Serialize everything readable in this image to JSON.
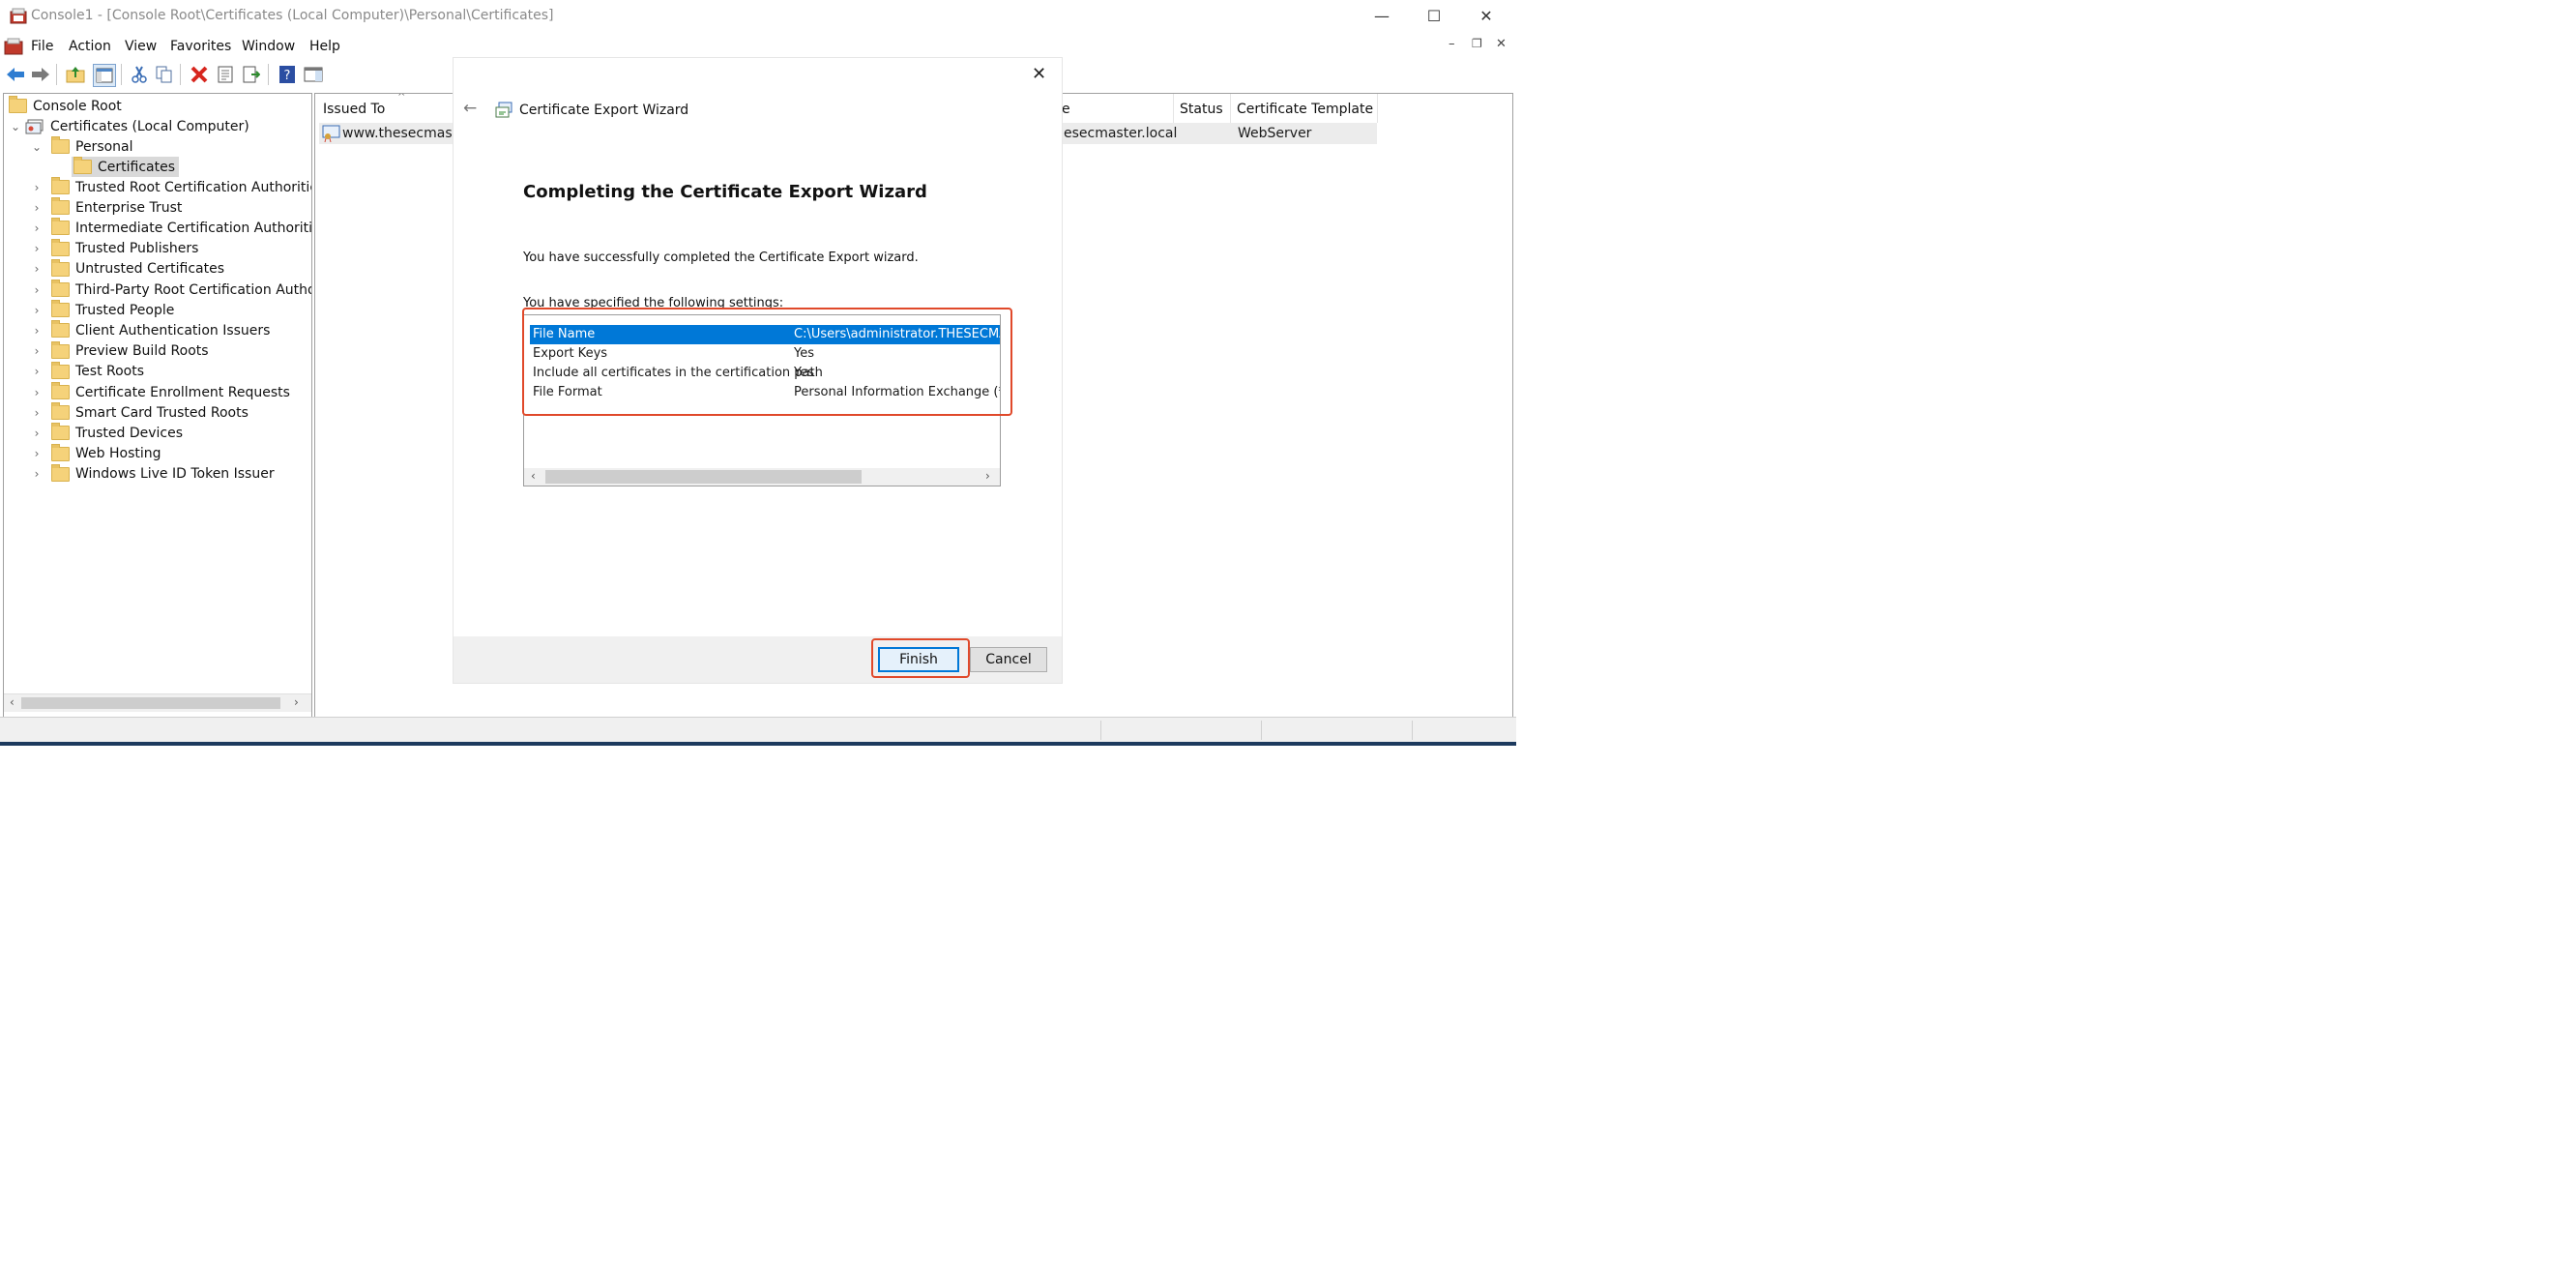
{
  "window": {
    "title": "Console1 - [Console Root\\Certificates (Local Computer)\\Personal\\Certificates]",
    "controls": {
      "minimize": "—",
      "maximize": "☐",
      "close": "✕"
    },
    "mdi_controls": {
      "minimize": "–",
      "restore": "❐",
      "close": "✕"
    }
  },
  "menu": [
    "File",
    "Action",
    "View",
    "Favorites",
    "Window",
    "Help"
  ],
  "tree": {
    "root": "Console Root",
    "store": "Certificates (Local Computer)",
    "personal": "Personal",
    "selected": "Certificates",
    "folders": [
      "Trusted Root Certification Authorities",
      "Enterprise Trust",
      "Intermediate Certification Authorities",
      "Trusted Publishers",
      "Untrusted Certificates",
      "Third-Party Root Certification Authorities",
      "Trusted People",
      "Client Authentication Issuers",
      "Preview Build Roots",
      "Test Roots",
      "Certificate Enrollment Requests",
      "Smart Card Trusted Roots",
      "Trusted Devices",
      "Web Hosting",
      "Windows Live ID Token Issuer"
    ]
  },
  "list": {
    "columns": {
      "issued_to": "Issued To",
      "issued_by_tail": "e",
      "status": "Status",
      "template": "Certificate Template"
    },
    "row": {
      "issued_to": "www.thesecmaster.l",
      "issued_by": "esecmaster.local",
      "status": "",
      "template": "WebServer"
    }
  },
  "wizard": {
    "title": "Certificate Export Wizard",
    "heading": "Completing the Certificate Export Wizard",
    "message": "You have successfully completed the Certificate Export wizard.",
    "settings_label": "You have specified the following settings:",
    "settings": [
      {
        "name": "File Name",
        "value": "C:\\Users\\administrator.THESECMASTE",
        "selected": true
      },
      {
        "name": "Export Keys",
        "value": "Yes",
        "selected": false
      },
      {
        "name": "Include all certificates in the certification path",
        "value": "Yes",
        "selected": false
      },
      {
        "name": "File Format",
        "value": "Personal Information Exchange (*.pfx)",
        "selected": false
      }
    ],
    "finish_label": "Finish",
    "cancel_label": "Cancel",
    "close_glyph": "✕",
    "back_glyph": "←"
  },
  "colors": {
    "selection": "#0078d7",
    "highlight_box": "#e0492a",
    "folder": "#f5d27a"
  }
}
